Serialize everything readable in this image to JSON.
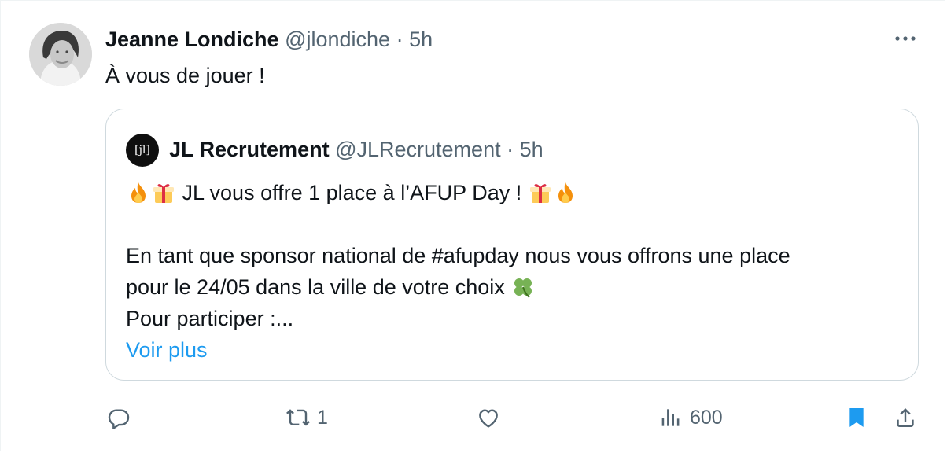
{
  "tweet": {
    "author_name": "Jeanne Londiche",
    "handle": "@jlondiche",
    "separator": "·",
    "time": "5h",
    "text": "À vous de jouer !"
  },
  "quote": {
    "avatar_text": "[jl]",
    "author_name": "JL Recrutement",
    "handle": "@JLRecrutement",
    "separator": "·",
    "time": "5h",
    "headline": "JL vous offre 1 place à l’AFUP Day !",
    "line1": "En tant que sponsor national de #afupday nous vous offrons une place",
    "line2": "pour le 24/05 dans la ville de votre choix",
    "line3": "Pour participer :...",
    "more_link": "Voir plus"
  },
  "actions": {
    "reply_count": "",
    "retweet_count": "1",
    "like_count": "",
    "views_count": "600"
  },
  "icons": {
    "more": "more-horizontal-icon",
    "reply": "reply-icon",
    "retweet": "retweet-icon",
    "like": "heart-icon",
    "views": "views-icon",
    "bookmark": "bookmark-icon",
    "share": "share-icon",
    "emoji_fire": "fire-emoji",
    "emoji_gift": "gift-emoji",
    "emoji_clover": "clover-emoji"
  },
  "colors": {
    "text": "#0f1419",
    "muted": "#536471",
    "link": "#1d9bf0",
    "border": "#cfd9de",
    "bookmark_active": "#1d9bf0"
  }
}
